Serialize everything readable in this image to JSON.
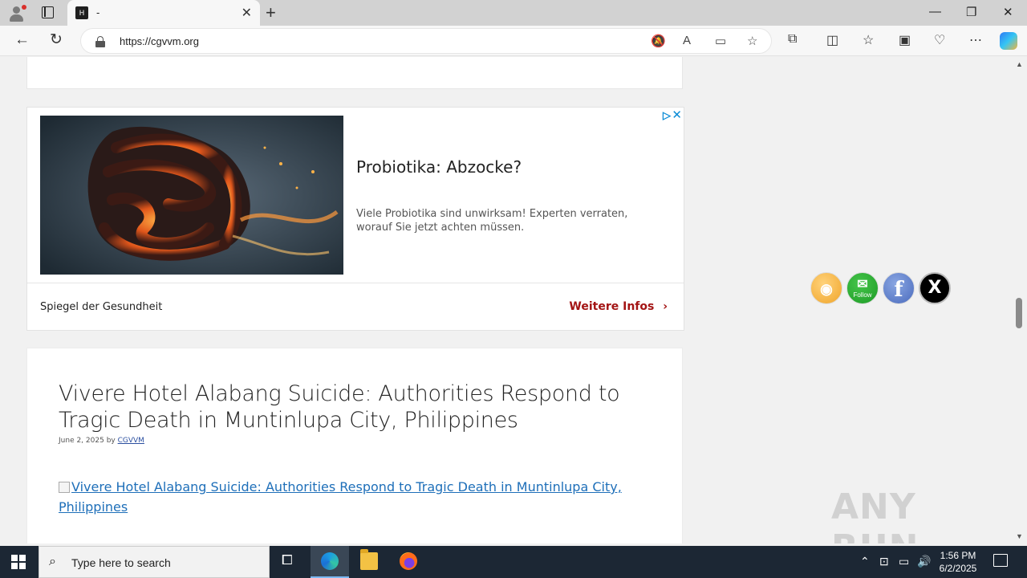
{
  "browser": {
    "tab_title": "-",
    "tab_favicon_text": "H",
    "url": "https://cgvvm.org",
    "window_controls": {
      "minimize": "—",
      "restore": "❐",
      "close": "✕"
    }
  },
  "ad": {
    "title": "Probiotika: Abzocke?",
    "description": "Viele Probiotika sind unwirksam! Experten verraten, worauf Sie jetzt achten müssen.",
    "source": "Spiegel der Gesundheit",
    "cta": "Weitere Infos",
    "cta_chevron": "›",
    "adchoices_glyph": "▷",
    "close_glyph": "✕"
  },
  "post": {
    "title": "Vivere Hotel Alabang Suicide: Authorities Respond to Tragic Death in Muntinlupa City, Philippines",
    "date": "June 2, 2025",
    "by": "by",
    "author": "CGVVM",
    "image_alt": "Vivere Hotel Alabang Suicide: Authorities Respond to Tragic Death in Muntinlupa City, Philippines"
  },
  "social": {
    "rss": "RSS",
    "mail_label": "Follow",
    "facebook": "f",
    "x": "X"
  },
  "watermark": "ANY RUN",
  "taskbar": {
    "search_placeholder": "Type here to search",
    "time": "1:56 PM",
    "date": "6/2/2025"
  },
  "colors": {
    "ad_cta": "#a31414",
    "link": "#1e6fb9",
    "taskbar": "#1c2734"
  }
}
